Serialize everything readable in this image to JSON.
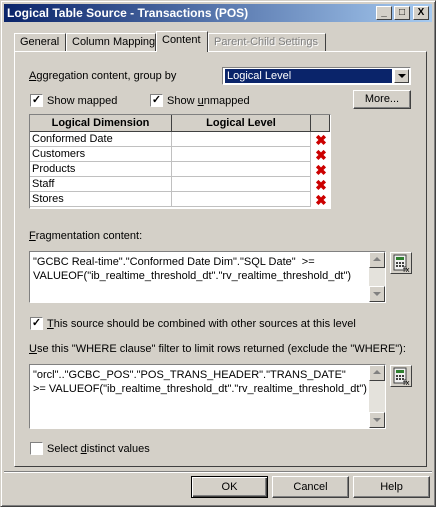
{
  "window": {
    "title": "Logical Table Source - Transactions (POS)",
    "minimize": "_",
    "maximize": "□",
    "close": "X"
  },
  "tabs": [
    {
      "label": "General",
      "state": "normal"
    },
    {
      "label": "Column Mapping",
      "state": "normal"
    },
    {
      "label": "Content",
      "state": "active"
    },
    {
      "label": "Parent-Child Settings",
      "state": "disabled"
    }
  ],
  "aggregation": {
    "label_accel": "A",
    "label_rest": "ggregation content, group by",
    "selected": "Logical Level"
  },
  "show_mapped": {
    "label": "Show mapped",
    "checked": true
  },
  "show_unmapped": {
    "label_prefix": "Show ",
    "label_accel": "u",
    "label_rest": "nmapped",
    "checked": true
  },
  "more_button": "More...",
  "grid": {
    "columns": [
      "Logical Dimension",
      "Logical Level"
    ],
    "rows": [
      {
        "dimension": "Conformed Date",
        "level": "",
        "icon": "delete-x-icon"
      },
      {
        "dimension": "Customers",
        "level": "",
        "icon": "delete-x-icon"
      },
      {
        "dimension": "Products",
        "level": "",
        "icon": "delete-x-icon"
      },
      {
        "dimension": "Staff",
        "level": "",
        "icon": "delete-x-icon"
      },
      {
        "dimension": "Stores",
        "level": "",
        "icon": "delete-x-icon"
      }
    ]
  },
  "fragmentation": {
    "label_accel": "F",
    "label_rest": "ragmentation content:",
    "text": "\"GCBC Real-time\".\"Conformed Date Dim\".\"SQL Date\"  >=\nVALUEOF(\"ib_realtime_threshold_dt\".\"rv_realtime_threshold_dt\")"
  },
  "combine": {
    "label_accel": "T",
    "label_rest": "his source should be combined with other sources at this level",
    "checked": true
  },
  "where": {
    "label_accel": "U",
    "label_rest": "se this \"WHERE clause\" filter to limit rows returned (exclude the \"WHERE\"):",
    "text": "\"orcl\"..\"GCBC_POS\".\"POS_TRANS_HEADER\".\"TRANS_DATE\"\n>= VALUEOF(\"ib_realtime_threshold_dt\".\"rv_realtime_threshold_dt\")"
  },
  "distinct": {
    "label_prefix": "Select ",
    "label_accel": "d",
    "label_rest": "istinct values",
    "checked": false
  },
  "buttons": {
    "ok": "OK",
    "cancel": "Cancel",
    "help": "Help"
  },
  "colors": {
    "titlebar_start": "#0a246a",
    "titlebar_end": "#a6caf0",
    "face": "#d4d0c8",
    "delete_icon": "#cc0000"
  }
}
